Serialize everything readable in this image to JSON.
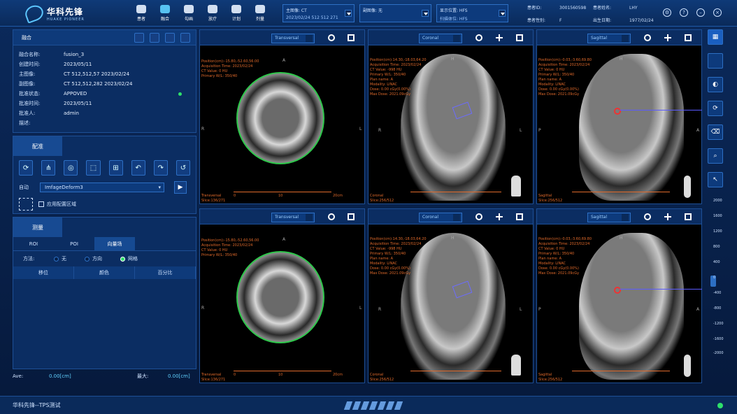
{
  "app": {
    "logo_cn": "华科先锋",
    "logo_en": "HUAKE PIONEER",
    "footer_title": "华科先锋--TPS测试"
  },
  "nav": [
    {
      "label": "患者",
      "icon": "patient-icon"
    },
    {
      "label": "融合",
      "icon": "fusion-icon"
    },
    {
      "label": "勾画",
      "icon": "contour-icon"
    },
    {
      "label": "放疗",
      "icon": "radiotherapy-icon"
    },
    {
      "label": "计划",
      "icon": "plan-icon"
    },
    {
      "label": "剂量",
      "icon": "dose-icon"
    }
  ],
  "selectors": {
    "primary_label": "主图像: CT",
    "primary_value": "2023/02/24   512 512 271",
    "secondary_label": "副图像: 无",
    "display_label": "显示位置: HFS",
    "scan_label": "扫描体位: HFS"
  },
  "patient": {
    "id_label": "患者ID:",
    "id": "3001560598",
    "name_label": "患者姓名:",
    "name": "LHY",
    "sex_label": "患者性别:",
    "sex": "F",
    "birth_label": "出生日期:",
    "birth": "1977/02/24"
  },
  "fusion": {
    "title": "融合",
    "rows": [
      {
        "k": "融合名称:",
        "v": "fusion_3"
      },
      {
        "k": "创建时间:",
        "v": "2023/05/11"
      },
      {
        "k": "主图像:",
        "v": "CT 512,512,57   2023/02/24"
      },
      {
        "k": "副图像:",
        "v": "CT 512,512,282   2023/02/24"
      },
      {
        "k": "批准状态:",
        "v": "APPOVED"
      },
      {
        "k": "批准时间:",
        "v": "2023/05/11"
      },
      {
        "k": "批准人:",
        "v": "admin"
      },
      {
        "k": "描述:",
        "v": ""
      }
    ]
  },
  "registration": {
    "title": "配准",
    "auto_label": "自动",
    "method": "ImfageDeform3",
    "apply_label": "应用配置区域"
  },
  "measure": {
    "title": "测量",
    "tabs": [
      "ROI",
      "POI",
      "向量场"
    ],
    "method_label": "方法:",
    "options": [
      "无",
      "方向",
      "网格"
    ],
    "columns": [
      "移位",
      "颜色",
      "百分比"
    ],
    "ave_label": "Ave:",
    "ave_value": "0.00[cm]",
    "max_label": "最大:",
    "max_value": "0.00[cm]"
  },
  "views": {
    "transversal": "Transversal",
    "coronal": "Coronal",
    "sagittal": "Sagittal",
    "trans_overlay": "Position(cm):-15.80,-52.60,56.00\nAcquisition Time: 2023/02/24\nCT Value: 0 HU\nPrimary W/L: 350/40",
    "cor_overlay": "Position(cm):14.30,-18.03,64.20\nAcquisition Time: 2023/02/24\nCT Value: -998 HU\nPrimary W/L: 350/40\nPlan name: A\nModality: LINAC\nDose: 0.00 cGy(0.00%)\nMax Dose: 2021.09cGy",
    "sag_overlay": "Position(cm):-0.03,-3.60,69.80\nAcquisition Time: 2023/02/24\nCT Value: 0 HU\nPrimary W/L: 350/40\nPlan name: A\nModality: LINAC\nDose: 0.00 cGy(0.00%)\nMax Dose: 2021.09cGy",
    "trans_slice": "Slice:136/271",
    "cor_slice": "Slice:256/512",
    "sag_slice": "Slice:256/512",
    "scale_0": "0",
    "scale_10": "10",
    "scale_20": "20cm"
  },
  "ruler": [
    "2000",
    "1600",
    "1200",
    "800",
    "400",
    "0",
    "-400",
    "-800",
    "-1200",
    "-1600",
    "-2000"
  ]
}
